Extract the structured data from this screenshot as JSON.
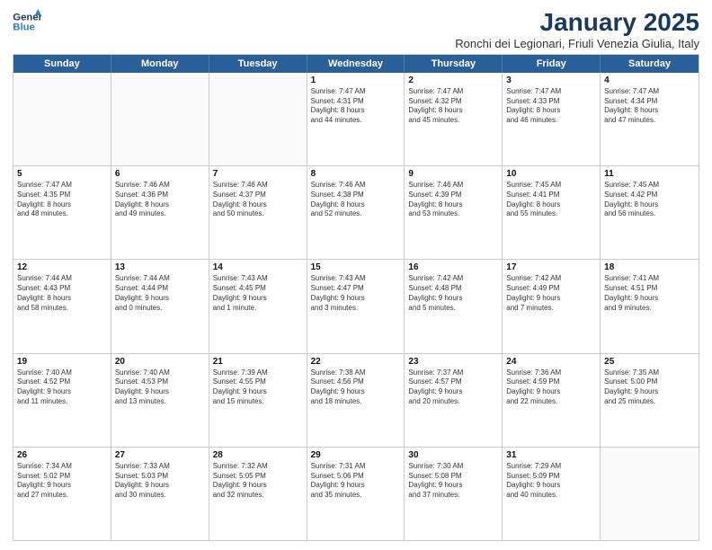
{
  "logo": {
    "line1": "General",
    "line2": "Blue"
  },
  "title": "January 2025",
  "subtitle": "Ronchi dei Legionari, Friuli Venezia Giulia, Italy",
  "days": [
    "Sunday",
    "Monday",
    "Tuesday",
    "Wednesday",
    "Thursday",
    "Friday",
    "Saturday"
  ],
  "weeks": [
    [
      {
        "day": "",
        "empty": true
      },
      {
        "day": "",
        "empty": true
      },
      {
        "day": "",
        "empty": true
      },
      {
        "day": "1",
        "lines": [
          "Sunrise: 7:47 AM",
          "Sunset: 4:31 PM",
          "Daylight: 8 hours",
          "and 44 minutes."
        ]
      },
      {
        "day": "2",
        "lines": [
          "Sunrise: 7:47 AM",
          "Sunset: 4:32 PM",
          "Daylight: 8 hours",
          "and 45 minutes."
        ]
      },
      {
        "day": "3",
        "lines": [
          "Sunrise: 7:47 AM",
          "Sunset: 4:33 PM",
          "Daylight: 8 hours",
          "and 46 minutes."
        ]
      },
      {
        "day": "4",
        "lines": [
          "Sunrise: 7:47 AM",
          "Sunset: 4:34 PM",
          "Daylight: 8 hours",
          "and 47 minutes."
        ]
      }
    ],
    [
      {
        "day": "5",
        "lines": [
          "Sunrise: 7:47 AM",
          "Sunset: 4:35 PM",
          "Daylight: 8 hours",
          "and 48 minutes."
        ]
      },
      {
        "day": "6",
        "lines": [
          "Sunrise: 7:46 AM",
          "Sunset: 4:36 PM",
          "Daylight: 8 hours",
          "and 49 minutes."
        ]
      },
      {
        "day": "7",
        "lines": [
          "Sunrise: 7:46 AM",
          "Sunset: 4:37 PM",
          "Daylight: 8 hours",
          "and 50 minutes."
        ]
      },
      {
        "day": "8",
        "lines": [
          "Sunrise: 7:46 AM",
          "Sunset: 4:38 PM",
          "Daylight: 8 hours",
          "and 52 minutes."
        ]
      },
      {
        "day": "9",
        "lines": [
          "Sunrise: 7:46 AM",
          "Sunset: 4:39 PM",
          "Daylight: 8 hours",
          "and 53 minutes."
        ]
      },
      {
        "day": "10",
        "lines": [
          "Sunrise: 7:45 AM",
          "Sunset: 4:41 PM",
          "Daylight: 8 hours",
          "and 55 minutes."
        ]
      },
      {
        "day": "11",
        "lines": [
          "Sunrise: 7:45 AM",
          "Sunset: 4:42 PM",
          "Daylight: 8 hours",
          "and 56 minutes."
        ]
      }
    ],
    [
      {
        "day": "12",
        "lines": [
          "Sunrise: 7:44 AM",
          "Sunset: 4:43 PM",
          "Daylight: 8 hours",
          "and 58 minutes."
        ]
      },
      {
        "day": "13",
        "lines": [
          "Sunrise: 7:44 AM",
          "Sunset: 4:44 PM",
          "Daylight: 9 hours",
          "and 0 minutes."
        ]
      },
      {
        "day": "14",
        "lines": [
          "Sunrise: 7:43 AM",
          "Sunset: 4:45 PM",
          "Daylight: 9 hours",
          "and 1 minute."
        ]
      },
      {
        "day": "15",
        "lines": [
          "Sunrise: 7:43 AM",
          "Sunset: 4:47 PM",
          "Daylight: 9 hours",
          "and 3 minutes."
        ]
      },
      {
        "day": "16",
        "lines": [
          "Sunrise: 7:42 AM",
          "Sunset: 4:48 PM",
          "Daylight: 9 hours",
          "and 5 minutes."
        ]
      },
      {
        "day": "17",
        "lines": [
          "Sunrise: 7:42 AM",
          "Sunset: 4:49 PM",
          "Daylight: 9 hours",
          "and 7 minutes."
        ]
      },
      {
        "day": "18",
        "lines": [
          "Sunrise: 7:41 AM",
          "Sunset: 4:51 PM",
          "Daylight: 9 hours",
          "and 9 minutes."
        ]
      }
    ],
    [
      {
        "day": "19",
        "lines": [
          "Sunrise: 7:40 AM",
          "Sunset: 4:52 PM",
          "Daylight: 9 hours",
          "and 11 minutes."
        ]
      },
      {
        "day": "20",
        "lines": [
          "Sunrise: 7:40 AM",
          "Sunset: 4:53 PM",
          "Daylight: 9 hours",
          "and 13 minutes."
        ]
      },
      {
        "day": "21",
        "lines": [
          "Sunrise: 7:39 AM",
          "Sunset: 4:55 PM",
          "Daylight: 9 hours",
          "and 15 minutes."
        ]
      },
      {
        "day": "22",
        "lines": [
          "Sunrise: 7:38 AM",
          "Sunset: 4:56 PM",
          "Daylight: 9 hours",
          "and 18 minutes."
        ]
      },
      {
        "day": "23",
        "lines": [
          "Sunrise: 7:37 AM",
          "Sunset: 4:57 PM",
          "Daylight: 9 hours",
          "and 20 minutes."
        ]
      },
      {
        "day": "24",
        "lines": [
          "Sunrise: 7:36 AM",
          "Sunset: 4:59 PM",
          "Daylight: 9 hours",
          "and 22 minutes."
        ]
      },
      {
        "day": "25",
        "lines": [
          "Sunrise: 7:35 AM",
          "Sunset: 5:00 PM",
          "Daylight: 9 hours",
          "and 25 minutes."
        ]
      }
    ],
    [
      {
        "day": "26",
        "lines": [
          "Sunrise: 7:34 AM",
          "Sunset: 5:02 PM",
          "Daylight: 9 hours",
          "and 27 minutes."
        ]
      },
      {
        "day": "27",
        "lines": [
          "Sunrise: 7:33 AM",
          "Sunset: 5:03 PM",
          "Daylight: 9 hours",
          "and 30 minutes."
        ]
      },
      {
        "day": "28",
        "lines": [
          "Sunrise: 7:32 AM",
          "Sunset: 5:05 PM",
          "Daylight: 9 hours",
          "and 32 minutes."
        ]
      },
      {
        "day": "29",
        "lines": [
          "Sunrise: 7:31 AM",
          "Sunset: 5:06 PM",
          "Daylight: 9 hours",
          "and 35 minutes."
        ]
      },
      {
        "day": "30",
        "lines": [
          "Sunrise: 7:30 AM",
          "Sunset: 5:08 PM",
          "Daylight: 9 hours",
          "and 37 minutes."
        ]
      },
      {
        "day": "31",
        "lines": [
          "Sunrise: 7:29 AM",
          "Sunset: 5:09 PM",
          "Daylight: 9 hours",
          "and 40 minutes."
        ]
      },
      {
        "day": "",
        "empty": true
      }
    ]
  ]
}
